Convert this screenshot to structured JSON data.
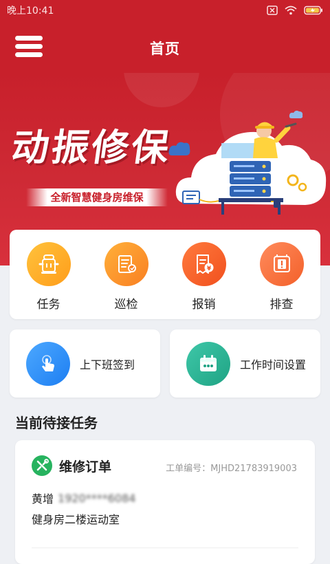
{
  "status_bar": {
    "time": "晚上10:41"
  },
  "header": {
    "title": "首页"
  },
  "banner": {
    "title": "动振修保",
    "subtitle": "全新智慧健身房维保"
  },
  "quick_actions": [
    {
      "label": "任务",
      "icon": "fire-hydrant-icon",
      "color_from": "#ffc23c",
      "color_to": "#ff9d1a"
    },
    {
      "label": "巡检",
      "icon": "inspection-icon",
      "color_from": "#ffb03a",
      "color_to": "#f97f22"
    },
    {
      "label": "报销",
      "icon": "receipt-icon",
      "color_from": "#ff7a3d",
      "color_to": "#f1501e"
    },
    {
      "label": "排查",
      "icon": "warning-box-icon",
      "color_from": "#ff8b5c",
      "color_to": "#f3602a"
    }
  ],
  "mid_actions": [
    {
      "label": "上下班签到",
      "icon": "touch-icon",
      "color_from": "#4ca8ff",
      "color_to": "#1d7ef2"
    },
    {
      "label": "工作时间设置",
      "icon": "calendar-icon",
      "color_from": "#3ec7a8",
      "color_to": "#1fa384"
    }
  ],
  "pending": {
    "section_title": "当前待接任务",
    "task": {
      "type": "维修订单",
      "order_no": "工单编号：MJHD21783919003",
      "contact_name": "黄增",
      "contact_phone": "1920****6084",
      "location": "健身房二楼运动室"
    }
  },
  "colors": {
    "primary": "#c8202b",
    "page_bg": "#eef0f4",
    "task_icon_green": "#27b35f"
  }
}
